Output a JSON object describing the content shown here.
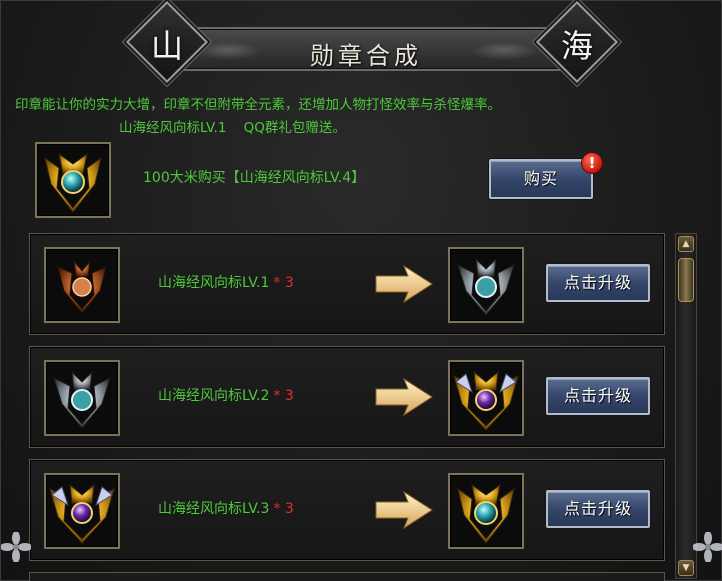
{
  "title": {
    "text": "勋章合成",
    "left_char": "山",
    "right_char": "海"
  },
  "description": {
    "line1": "印章能让你的实力大增，印章不但附带全元素，还增加人物打怪效率与杀怪爆率。",
    "line2": "山海经风向标LV.1    QQ群礼包赠送。"
  },
  "purchase": {
    "text_prefix": "100大米购买",
    "item": "【山海经风向标LV.4】",
    "button": "购买",
    "alert": "!"
  },
  "upgrades": [
    {
      "name": "山海经风向标LV.1",
      "times": "* 3",
      "button": "点击升级",
      "from_icon": "bronze-medal-icon",
      "to_icon": "silver-medal-icon"
    },
    {
      "name": "山海经风向标LV.2",
      "times": "* 3",
      "button": "点击升级",
      "from_icon": "silver-medal-icon",
      "to_icon": "purple-gold-medal-icon"
    },
    {
      "name": "山海经风向标LV.3",
      "times": "* 3",
      "button": "点击升级",
      "from_icon": "purple-gold-medal-icon",
      "to_icon": "gold-medal-icon"
    }
  ],
  "colors": {
    "green_text": "#4ec93b",
    "red_text": "#e0302a",
    "button_blue": "#34466a"
  }
}
